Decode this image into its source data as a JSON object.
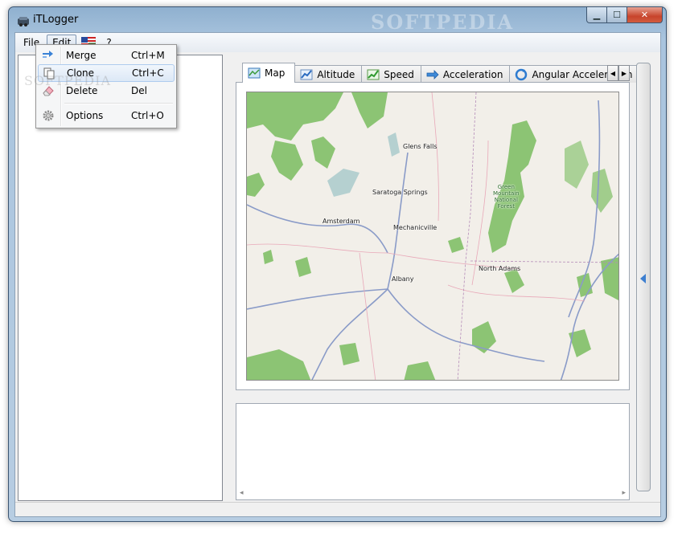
{
  "window": {
    "title": "iTLogger",
    "watermark": "SOFTPEDIA",
    "controls": {
      "minimize": "▁",
      "maximize": "☐",
      "close": "✕"
    }
  },
  "menubar": {
    "items": [
      {
        "label": "File"
      },
      {
        "label": "Edit"
      },
      {
        "label": "?"
      }
    ]
  },
  "edit_menu": {
    "items": [
      {
        "label": "Merge",
        "shortcut": "Ctrl+M",
        "icon": "merge-icon"
      },
      {
        "label": "Clone",
        "shortcut": "Ctrl+C",
        "icon": "clone-icon"
      },
      {
        "label": "Delete",
        "shortcut": "Del",
        "icon": "eraser-icon"
      },
      {
        "label": "Options",
        "shortcut": "Ctrl+O",
        "icon": "gear-icon"
      }
    ],
    "ghost_watermark": "SOFTPEDIA"
  },
  "tabs": {
    "items": [
      {
        "label": "Map",
        "icon": "map-icon"
      },
      {
        "label": "Altitude",
        "icon": "altitude-chart-icon"
      },
      {
        "label": "Speed",
        "icon": "speed-chart-icon"
      },
      {
        "label": "Acceleration",
        "icon": "acceleration-arrow-icon"
      },
      {
        "label": "Angular Acceleration",
        "icon": "angular-arrow-icon"
      }
    ],
    "active": "Map"
  },
  "map": {
    "places": [
      {
        "name": "Glens Falls"
      },
      {
        "name": "Saratoga Springs"
      },
      {
        "name": "Amsterdam"
      },
      {
        "name": "Mechanicville"
      },
      {
        "name": "Albany"
      },
      {
        "name": "North Adams"
      }
    ],
    "forest_label": [
      "Green",
      "Mountain",
      "National",
      "Forest"
    ]
  },
  "colors": {
    "forest": "#8cc474",
    "road": "#8a9bc8",
    "minor_road": "#e8a8b8",
    "water": "#b5d0d0",
    "land": "#f2efe9"
  }
}
